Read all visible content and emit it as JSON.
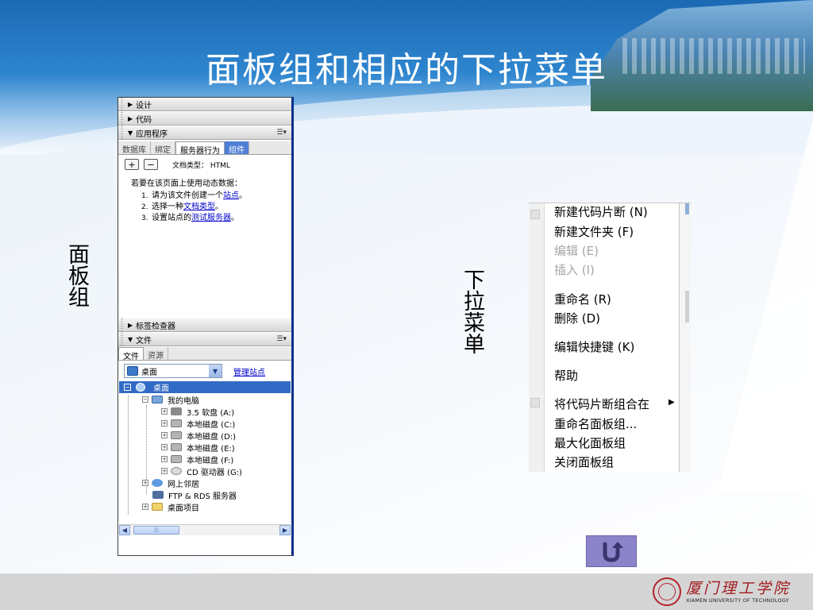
{
  "slide": {
    "title": "面板组和相应的下拉菜单",
    "label_left": "面板组",
    "label_right": "下拉菜单"
  },
  "panel_group": {
    "headers": {
      "design": "设计",
      "code": "代码",
      "application": "应用程序",
      "tag_inspector": "标签检查器",
      "files": "文件"
    },
    "app_tabs": [
      "数据库",
      "绑定",
      "服务器行为",
      "组件"
    ],
    "app_active_tab": "服务器行为",
    "add_button": "+",
    "remove_button": "−",
    "doc_type": "文档类型： HTML",
    "instructions_title": "若要在该页面上使用动态数据：",
    "steps": [
      {
        "num": "1.",
        "text": "请为该文件创建一个",
        "link": "站点",
        "suffix": "。"
      },
      {
        "num": "2.",
        "text": "选择一种",
        "link": "文档类型",
        "suffix": "。"
      },
      {
        "num": "3.",
        "text": "设置站点的",
        "link": "测试服务器",
        "suffix": "。"
      }
    ],
    "file_tabs": [
      "文件",
      "资源"
    ],
    "location_value": "桌面",
    "manage_sites": "管理站点",
    "tree_root": "桌面",
    "tree": {
      "my_computer": "我的电脑",
      "floppy": "3.5 软盘 (A:)",
      "disk_c": "本地磁盘 (C:)",
      "disk_d": "本地磁盘 (D:)",
      "disk_e": "本地磁盘 (E:)",
      "disk_f": "本地磁盘 (F:)",
      "cd": "CD 驱动器 (G:)",
      "network": "网上邻居",
      "ftp": "FTP & RDS 服务器",
      "desktop_items": "桌面项目"
    },
    "scroll_thumb": "|||"
  },
  "context_menu": {
    "items": {
      "new_snippet": "新建代码片断 (N)",
      "new_folder": "新建文件夹 (F)",
      "edit": "编辑 (E)",
      "insert": "插入 (I)",
      "rename": "重命名 (R)",
      "delete": "删除 (D)",
      "edit_shortcuts": "编辑快捷键 (K)",
      "help": "帮助",
      "group_with": "将代码片断组合在",
      "rename_group": "重命名面板组...",
      "maximize_group": "最大化面板组",
      "close_group": "关闭面板组"
    }
  },
  "footer": {
    "logo_cn": "厦门理工学院",
    "logo_en": "XIAMEN UNIVERSITY OF TECHNOLOGY"
  },
  "colors": {
    "header_blue": "#2e86cf",
    "selection_blue": "#316ac5",
    "link_blue": "#0000cc",
    "return_button": "#8c83c8",
    "logo_red": "#a0191f"
  },
  "icons": {
    "return": "return-arrow-icon",
    "seal": "university-seal-icon"
  }
}
